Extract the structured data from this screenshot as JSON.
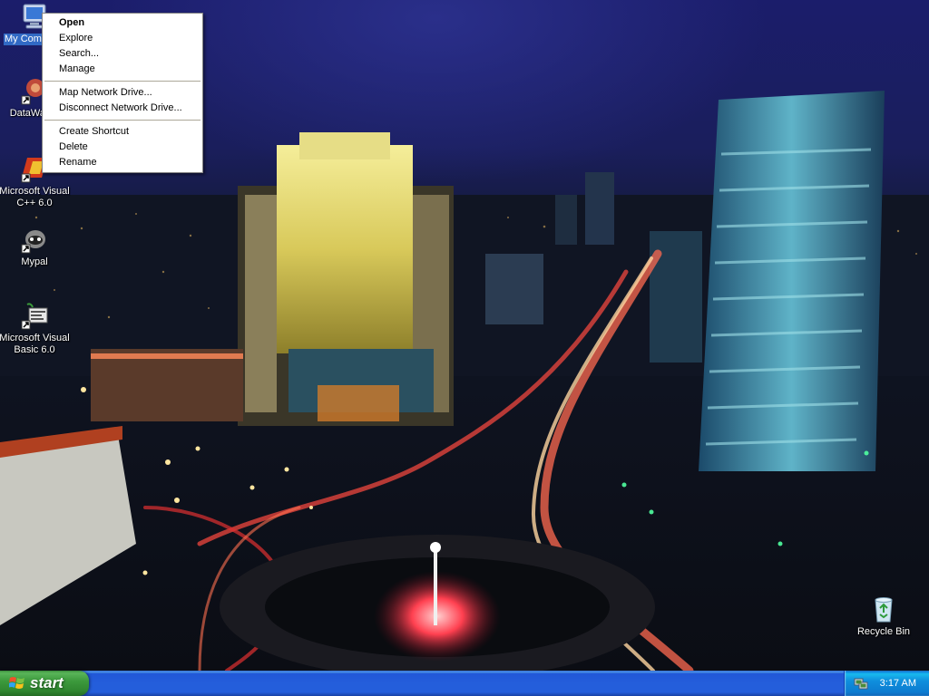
{
  "desktop": {
    "icons": [
      {
        "label": "My Computer",
        "glyph": "computer-icon"
      },
      {
        "label": "DataWag...",
        "glyph": "datawag-icon"
      },
      {
        "label": "Microsoft Visual C++ 6.0",
        "glyph": "visual-cpp-icon"
      },
      {
        "label": "Mypal",
        "glyph": "mypal-icon"
      },
      {
        "label": "Microsoft Visual Basic 6.0",
        "glyph": "visual-basic-icon"
      },
      {
        "label": "Recycle Bin",
        "glyph": "recycle-bin-icon"
      }
    ]
  },
  "context_menu": {
    "items": [
      {
        "label": "Open",
        "default": true
      },
      {
        "label": "Explore"
      },
      {
        "label": "Search..."
      },
      {
        "label": "Manage"
      },
      {
        "label": "Map Network Drive..."
      },
      {
        "label": "Disconnect Network Drive..."
      },
      {
        "label": "Create Shortcut"
      },
      {
        "label": "Delete"
      },
      {
        "label": "Rename"
      }
    ]
  },
  "taskbar": {
    "start_label": "start",
    "clock": "3:17 AM"
  },
  "colors": {
    "selection": "#316ac5",
    "taskbar_blue": "#245edb",
    "start_green": "#3d9a3d"
  }
}
